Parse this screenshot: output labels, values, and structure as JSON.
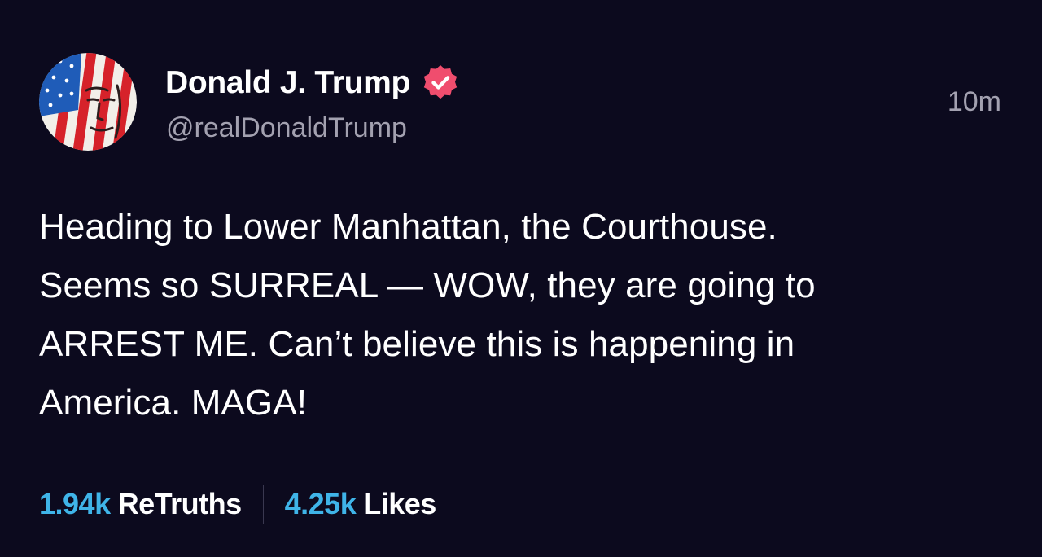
{
  "post": {
    "author": {
      "display_name": "Donald J. Trump",
      "handle": "@realDonaldTrump",
      "verified": true,
      "avatar_icon": "flag-portrait-avatar"
    },
    "timestamp": "10m",
    "body_lines": [
      "Heading to Lower Manhattan, the Courthouse.",
      "Seems so SURREAL — WOW, they are going to",
      "ARREST ME. Can’t believe this is happening in",
      "America. MAGA!"
    ],
    "stats": {
      "retruths": {
        "count": "1.94k",
        "label": "ReTruths"
      },
      "likes": {
        "count": "4.25k",
        "label": "Likes"
      }
    }
  },
  "colors": {
    "background": "#0c0a1e",
    "text": "#ffffff",
    "muted": "#a3a1b0",
    "accent_count": "#3fb4e8",
    "verified_badge": "#f04d6e"
  }
}
